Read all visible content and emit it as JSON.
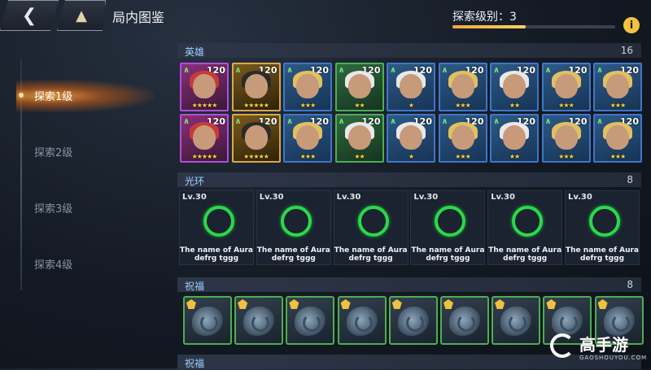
{
  "header": {
    "back_icon": "back-arrow-icon",
    "home_icon": "arena-home-icon",
    "title": "局内图鉴",
    "level_label": "探索级别：3",
    "level_progress": 0.45,
    "info_label": "i"
  },
  "sidebar": {
    "items": [
      {
        "label": "探索1级",
        "active": true
      },
      {
        "label": "探索2级",
        "active": false
      },
      {
        "label": "探索3级",
        "active": false
      },
      {
        "label": "探索4级",
        "active": false
      }
    ]
  },
  "heroes": {
    "title": "英雄",
    "count": "16",
    "rows": [
      [
        {
          "level": "120",
          "stars": "★★★★★",
          "tier": "purple"
        },
        {
          "level": "120",
          "stars": "★★★★★",
          "tier": "gold"
        },
        {
          "level": "120",
          "stars": "★★★",
          "tier": "blue"
        },
        {
          "level": "120",
          "stars": "★★",
          "tier": "green"
        },
        {
          "level": "120",
          "stars": "★",
          "tier": "blue"
        },
        {
          "level": "120",
          "stars": "★★★",
          "tier": "blue"
        },
        {
          "level": "120",
          "stars": "★★",
          "tier": "blue"
        },
        {
          "level": "120",
          "stars": "★★★",
          "tier": "blue"
        },
        {
          "level": "120",
          "stars": "★★★",
          "tier": "blue"
        }
      ],
      [
        {
          "level": "120",
          "stars": "★★★★★",
          "tier": "purple"
        },
        {
          "level": "120",
          "stars": "★★★★★",
          "tier": "gold"
        },
        {
          "level": "120",
          "stars": "★★★",
          "tier": "blue"
        },
        {
          "level": "120",
          "stars": "★★",
          "tier": "green"
        },
        {
          "level": "120",
          "stars": "★",
          "tier": "blue"
        },
        {
          "level": "120",
          "stars": "★★★",
          "tier": "blue"
        },
        {
          "level": "120",
          "stars": "★★",
          "tier": "blue"
        },
        {
          "level": "120",
          "stars": "★★★",
          "tier": "blue"
        },
        {
          "level": "120",
          "stars": "★★★",
          "tier": "blue"
        }
      ]
    ]
  },
  "auras": {
    "title": "光环",
    "count": "8",
    "items": [
      {
        "level": "Lv.30",
        "name": "The name of Aura defrg tggg"
      },
      {
        "level": "Lv.30",
        "name": "The name of Aura defrg tggg"
      },
      {
        "level": "Lv.30",
        "name": "The name of Aura defrg tggg"
      },
      {
        "level": "Lv.30",
        "name": "The name of Aura defrg tggg"
      },
      {
        "level": "Lv.30",
        "name": "The name of Aura defrg tggg"
      },
      {
        "level": "Lv.30",
        "name": "The name of Aura defrg tggg"
      }
    ]
  },
  "blessings": {
    "title": "祝福",
    "count": "8",
    "item_count": 9
  },
  "blessings2": {
    "title": "祝福"
  },
  "watermark": {
    "brand": "高手游",
    "url": "GAOSHOUYOU.COM"
  },
  "colors": {
    "accent": "#f3c33d",
    "progress": "#f0a83a",
    "aura_ring": "#2bd84a"
  }
}
